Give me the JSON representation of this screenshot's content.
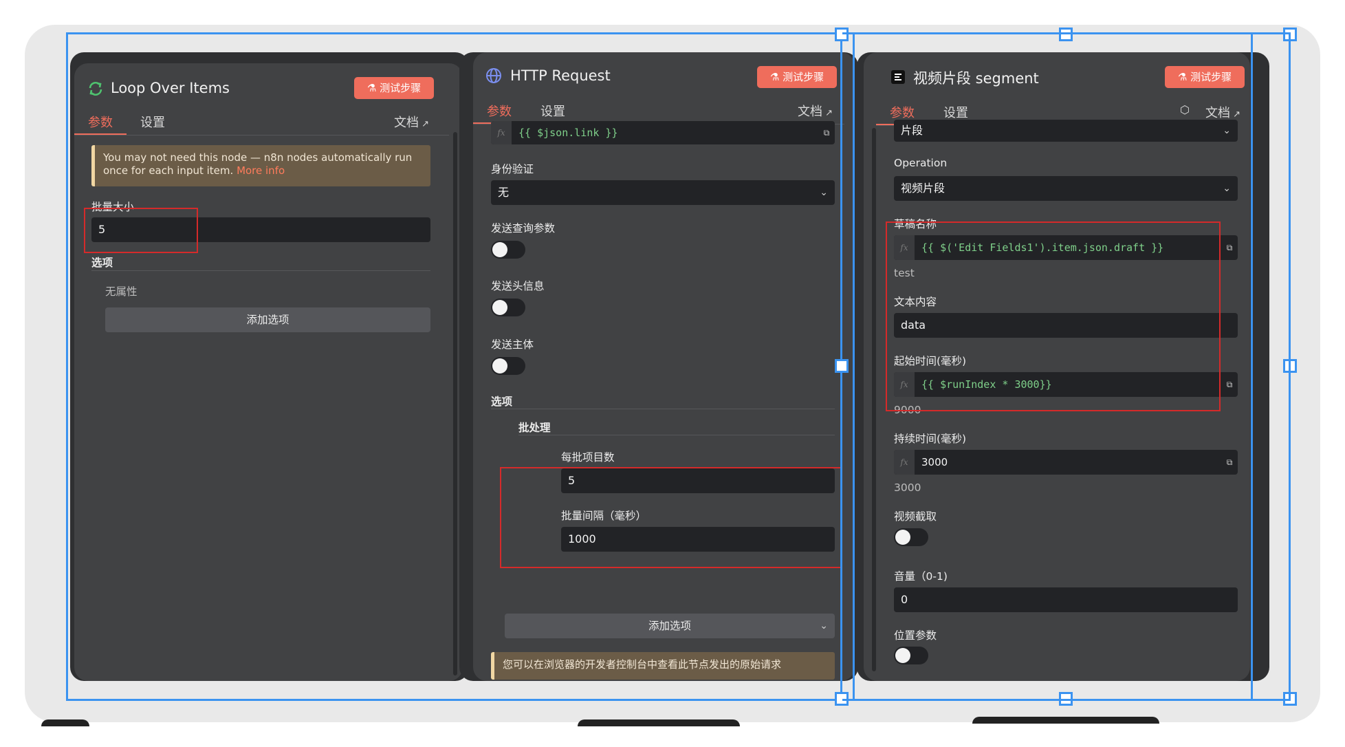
{
  "colors": {
    "accent": "#ef6d5c",
    "selection": "#3b93f0",
    "annotation": "#d52a2a",
    "panel": "#414244"
  },
  "panel1": {
    "title": "Loop Over Items",
    "test_button": "测试步骤",
    "tabs": {
      "params": "参数",
      "settings": "设置",
      "docs": "文档"
    },
    "notice_text": "You may not need this node — n8n nodes automatically run once for each input item.",
    "notice_link": "More info",
    "batch_size_label": "批量大小",
    "batch_size_value": "5",
    "options_label": "选项",
    "no_properties": "无属性",
    "add_option": "添加选项"
  },
  "panel2": {
    "title": "HTTP Request",
    "test_button": "测试步骤",
    "tabs": {
      "params": "参数",
      "settings": "设置",
      "docs": "文档"
    },
    "url_expression": "{{ $json.link }}",
    "auth_label": "身份验证",
    "auth_value": "无",
    "send_query_label": "发送查询参数",
    "send_headers_label": "发送头信息",
    "send_body_label": "发送主体",
    "options_label": "选项",
    "batching_label": "批处理",
    "items_per_batch_label": "每批项目数",
    "items_per_batch_value": "5",
    "batch_interval_label": "批量间隔（毫秒）",
    "batch_interval_value": "1000",
    "add_option": "添加选项",
    "notice_text": "您可以在浏览器的开发者控制台中查看此节点发出的原始请求"
  },
  "panel3": {
    "title": "视频片段 segment",
    "test_button": "测试步骤",
    "tabs": {
      "params": "参数",
      "settings": "设置",
      "docs": "文档"
    },
    "resource_value": "片段",
    "operation_label": "Operation",
    "operation_value": "视频片段",
    "draft_name_label": "草稿名称",
    "draft_name_expression": "{{ $('Edit Fields1').item.json.draft }}",
    "draft_name_result": "test",
    "text_content_label": "文本内容",
    "text_content_value": "data",
    "start_time_label": "起始时间(毫秒)",
    "start_time_expression": "{{ $runIndex * 3000}}",
    "start_time_result": "9000",
    "duration_label": "持续时间(毫秒)",
    "duration_value": "3000",
    "duration_result": "3000",
    "video_clip_label": "视频截取",
    "volume_label": "音量（0-1)",
    "volume_value": "0",
    "position_label": "位置参数"
  }
}
